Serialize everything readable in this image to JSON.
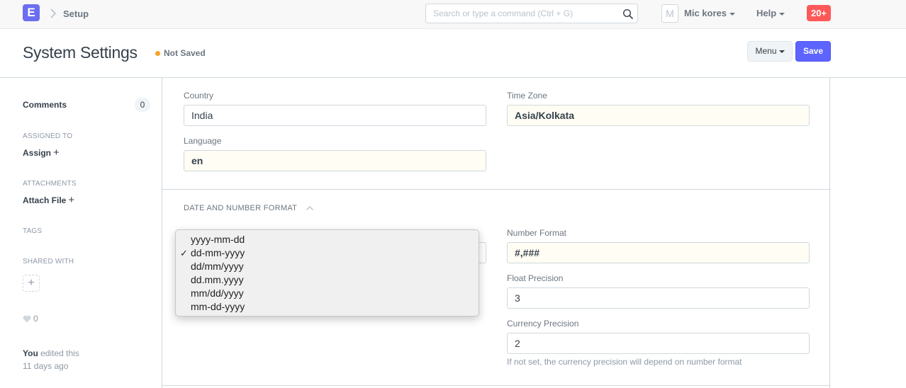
{
  "navbar": {
    "logo_letter": "E",
    "breadcrumb": "Setup",
    "search_placeholder": "Search or type a command (Ctrl + G)",
    "avatar_letter": "M",
    "user_name": "Mic kores",
    "help_label": "Help",
    "notification_badge": "20+"
  },
  "page": {
    "title": "System Settings",
    "status": "Not Saved",
    "menu_label": "Menu",
    "save_label": "Save"
  },
  "sidebar": {
    "comments_label": "Comments",
    "comments_count": "0",
    "assigned_to_label": "ASSIGNED TO",
    "assign_label": "Assign",
    "attachments_label": "ATTACHMENTS",
    "attach_label": "Attach File",
    "tags_label": "TAGS",
    "shared_with_label": "SHARED WITH",
    "likes_count": "0",
    "edit_actor": "You",
    "edit_text": "edited this",
    "edit_time": "11 days ago"
  },
  "form": {
    "country_label": "Country",
    "country_value": "India",
    "timezone_label": "Time Zone",
    "timezone_value": "Asia/Kolkata",
    "language_label": "Language",
    "language_value": "en",
    "section_title": "DATE AND NUMBER FORMAT",
    "number_format_label": "Number Format",
    "number_format_value": "#,###",
    "float_precision_label": "Float Precision",
    "float_precision_value": "3",
    "currency_precision_label": "Currency Precision",
    "currency_precision_value": "2",
    "currency_help": "If not set, the currency precision will depend on number format"
  },
  "date_format_dropdown": {
    "selected": "dd-mm-yyyy",
    "options": [
      "yyyy-mm-dd",
      "dd-mm-yyyy",
      "dd/mm/yyyy",
      "dd.mm.yyyy",
      "mm/dd/yyyy",
      "mm-dd-yyyy"
    ]
  },
  "colors": {
    "brand": "#6c6ef0",
    "primary_button": "#5e64ff",
    "notification": "#ff5858",
    "status_dot": "#f8a22a"
  }
}
